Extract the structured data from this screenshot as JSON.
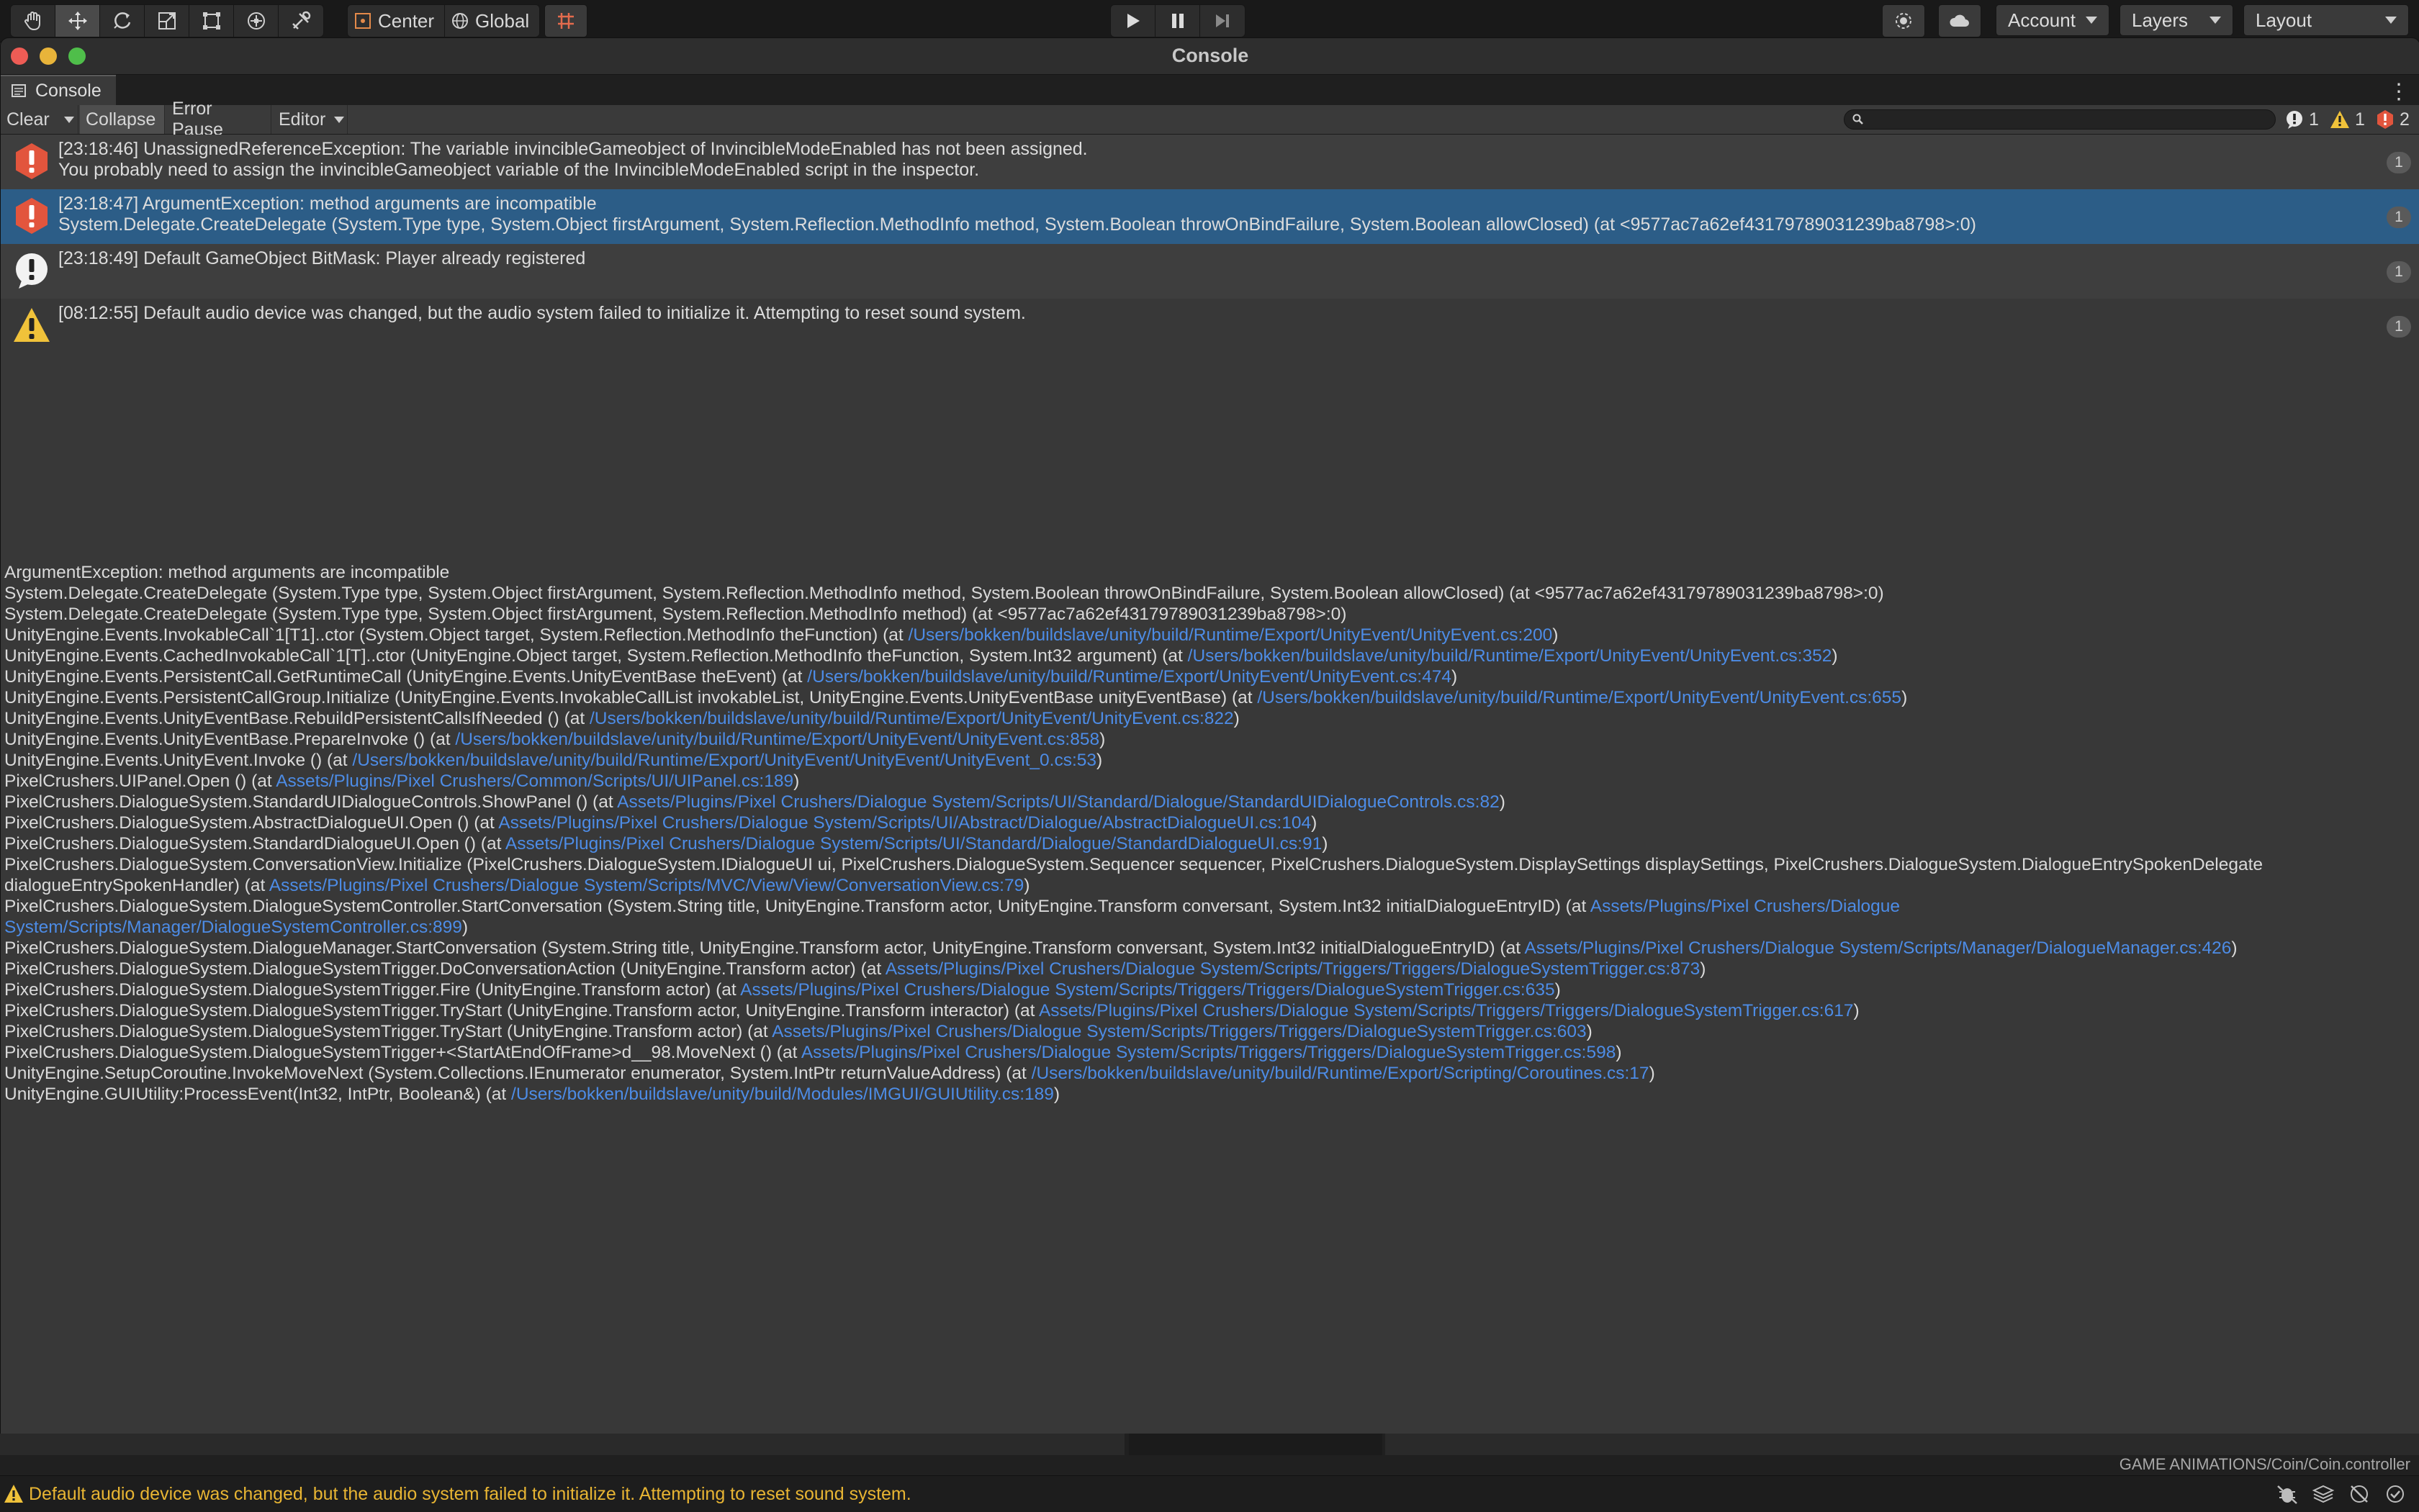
{
  "toolbar": {
    "tools": [
      "hand-tool",
      "move-tool",
      "rotate-tool",
      "scale-tool",
      "rect-tool",
      "transform-tool",
      "custom-tool"
    ],
    "pivot_label": "Center",
    "space_label": "Global",
    "account_label": "Account",
    "layers_label": "Layers",
    "layout_label": "Layout"
  },
  "window": {
    "title": "Console",
    "tab_label": "Console"
  },
  "console_toolbar": {
    "clear_label": "Clear",
    "collapse_label": "Collapse",
    "error_pause_label": "Error Pause",
    "editor_label": "Editor",
    "search_value": "",
    "info_count": "1",
    "warning_count": "1",
    "error_count": "2"
  },
  "logs": [
    {
      "type": "error",
      "line1": "[23:18:46] UnassignedReferenceException: The variable invincibleGameobject of InvincibleModeEnabled has not been assigned.",
      "line2": "You probably need to assign the invincibleGameobject variable of the InvincibleModeEnabled script in the inspector.",
      "count": "1"
    },
    {
      "type": "error",
      "line1": "[23:18:47] ArgumentException: method arguments are incompatible",
      "line2": "System.Delegate.CreateDelegate (System.Type type, System.Object firstArgument, System.Reflection.MethodInfo method, System.Boolean throwOnBindFailure, System.Boolean allowClosed) (at <9577ac7a62ef43179789031239ba8798>:0)",
      "count": "1"
    },
    {
      "type": "info",
      "line1": "[23:18:49] Default GameObject BitMask: Player already registered",
      "line2": "",
      "count": "1"
    },
    {
      "type": "warning",
      "line1": "[08:12:55] Default audio device was changed, but the audio system failed to initialize it. Attempting to reset sound system.",
      "line2": "",
      "count": "1"
    }
  ],
  "stack_trace": [
    {
      "text": "ArgumentException: method arguments are incompatible",
      "link": ""
    },
    {
      "text": "System.Delegate.CreateDelegate (System.Type type, System.Object firstArgument, System.Reflection.MethodInfo method, System.Boolean throwOnBindFailure, System.Boolean allowClosed) (at <9577ac7a62ef43179789031239ba8798>:0)",
      "link": ""
    },
    {
      "text": "System.Delegate.CreateDelegate (System.Type type, System.Object firstArgument, System.Reflection.MethodInfo method) (at <9577ac7a62ef43179789031239ba8798>:0)",
      "link": ""
    },
    {
      "text": "UnityEngine.Events.InvokableCall`1[T1]..ctor (System.Object target, System.Reflection.MethodInfo theFunction) (at ",
      "link": "/Users/bokken/buildslave/unity/build/Runtime/Export/UnityEvent/UnityEvent.cs:200",
      "tail": ")"
    },
    {
      "text": "UnityEngine.Events.CachedInvokableCall`1[T]..ctor (UnityEngine.Object target, System.Reflection.MethodInfo theFunction, System.Int32 argument) (at ",
      "link": "/Users/bokken/buildslave/unity/build/Runtime/Export/UnityEvent/UnityEvent.cs:352",
      "tail": ")"
    },
    {
      "text": "UnityEngine.Events.PersistentCall.GetRuntimeCall (UnityEngine.Events.UnityEventBase theEvent) (at ",
      "link": "/Users/bokken/buildslave/unity/build/Runtime/Export/UnityEvent/UnityEvent.cs:474",
      "tail": ")"
    },
    {
      "text": "UnityEngine.Events.PersistentCallGroup.Initialize (UnityEngine.Events.InvokableCallList invokableList, UnityEngine.Events.UnityEventBase unityEventBase) (at ",
      "link": "/Users/bokken/buildslave/unity/build/Runtime/Export/UnityEvent/UnityEvent.cs:655",
      "tail": ")"
    },
    {
      "text": "UnityEngine.Events.UnityEventBase.RebuildPersistentCallsIfNeeded () (at ",
      "link": "/Users/bokken/buildslave/unity/build/Runtime/Export/UnityEvent/UnityEvent.cs:822",
      "tail": ")"
    },
    {
      "text": "UnityEngine.Events.UnityEventBase.PrepareInvoke () (at ",
      "link": "/Users/bokken/buildslave/unity/build/Runtime/Export/UnityEvent/UnityEvent.cs:858",
      "tail": ")"
    },
    {
      "text": "UnityEngine.Events.UnityEvent.Invoke () (at ",
      "link": "/Users/bokken/buildslave/unity/build/Runtime/Export/UnityEvent/UnityEvent/UnityEvent_0.cs:53",
      "tail": ")"
    },
    {
      "text": "PixelCrushers.UIPanel.Open () (at ",
      "link": "Assets/Plugins/Pixel Crushers/Common/Scripts/UI/UIPanel.cs:189",
      "tail": ")"
    },
    {
      "text": "PixelCrushers.DialogueSystem.StandardUIDialogueControls.ShowPanel () (at ",
      "link": "Assets/Plugins/Pixel Crushers/Dialogue System/Scripts/UI/Standard/Dialogue/StandardUIDialogueControls.cs:82",
      "tail": ")"
    },
    {
      "text": "PixelCrushers.DialogueSystem.AbstractDialogueUI.Open () (at ",
      "link": "Assets/Plugins/Pixel Crushers/Dialogue System/Scripts/UI/Abstract/Dialogue/AbstractDialogueUI.cs:104",
      "tail": ")"
    },
    {
      "text": "PixelCrushers.DialogueSystem.StandardDialogueUI.Open () (at ",
      "link": "Assets/Plugins/Pixel Crushers/Dialogue System/Scripts/UI/Standard/Dialogue/StandardDialogueUI.cs:91",
      "tail": ")"
    },
    {
      "text": "PixelCrushers.DialogueSystem.ConversationView.Initialize (PixelCrushers.DialogueSystem.IDialogueUI ui, PixelCrushers.DialogueSystem.Sequencer sequencer, PixelCrushers.DialogueSystem.DisplaySettings displaySettings, PixelCrushers.DialogueSystem.DialogueEntrySpokenDelegate",
      "link": "",
      "tail": ""
    },
    {
      "text": "dialogueEntrySpokenHandler) (at ",
      "link": "Assets/Plugins/Pixel Crushers/Dialogue System/Scripts/MVC/View/View/ConversationView.cs:79",
      "tail": ")"
    },
    {
      "text": "PixelCrushers.DialogueSystem.DialogueSystemController.StartConversation (System.String title, UnityEngine.Transform actor, UnityEngine.Transform conversant, System.Int32 initialDialogueEntryID) (at ",
      "link": "Assets/Plugins/Pixel Crushers/Dialogue",
      "tail": ""
    },
    {
      "text": "",
      "link": "System/Scripts/Manager/DialogueSystemController.cs:899",
      "tail": ")"
    },
    {
      "text": "PixelCrushers.DialogueSystem.DialogueManager.StartConversation (System.String title, UnityEngine.Transform actor, UnityEngine.Transform conversant, System.Int32 initialDialogueEntryID) (at ",
      "link": "Assets/Plugins/Pixel Crushers/Dialogue System/Scripts/Manager/DialogueManager.cs:426",
      "tail": ")"
    },
    {
      "text": "PixelCrushers.DialogueSystem.DialogueSystemTrigger.DoConversationAction (UnityEngine.Transform actor) (at ",
      "link": "Assets/Plugins/Pixel Crushers/Dialogue System/Scripts/Triggers/Triggers/DialogueSystemTrigger.cs:873",
      "tail": ")"
    },
    {
      "text": "PixelCrushers.DialogueSystem.DialogueSystemTrigger.Fire (UnityEngine.Transform actor) (at ",
      "link": "Assets/Plugins/Pixel Crushers/Dialogue System/Scripts/Triggers/Triggers/DialogueSystemTrigger.cs:635",
      "tail": ")"
    },
    {
      "text": "PixelCrushers.DialogueSystem.DialogueSystemTrigger.TryStart (UnityEngine.Transform actor, UnityEngine.Transform interactor) (at ",
      "link": "Assets/Plugins/Pixel Crushers/Dialogue System/Scripts/Triggers/Triggers/DialogueSystemTrigger.cs:617",
      "tail": ")"
    },
    {
      "text": "PixelCrushers.DialogueSystem.DialogueSystemTrigger.TryStart (UnityEngine.Transform actor) (at ",
      "link": "Assets/Plugins/Pixel Crushers/Dialogue System/Scripts/Triggers/Triggers/DialogueSystemTrigger.cs:603",
      "tail": ")"
    },
    {
      "text": "PixelCrushers.DialogueSystem.DialogueSystemTrigger+<StartAtEndOfFrame>d__98.MoveNext () (at ",
      "link": "Assets/Plugins/Pixel Crushers/Dialogue System/Scripts/Triggers/Triggers/DialogueSystemTrigger.cs:598",
      "tail": ")"
    },
    {
      "text": "UnityEngine.SetupCoroutine.InvokeMoveNext (System.Collections.IEnumerator enumerator, System.IntPtr returnValueAddress) (at ",
      "link": "/Users/bokken/buildslave/unity/build/Runtime/Export/Scripting/Coroutines.cs:17",
      "tail": ")"
    },
    {
      "text": "UnityEngine.GUIUtility:ProcessEvent(Int32, IntPtr, Boolean&) (at ",
      "link": "/Users/bokken/buildslave/unity/build/Modules/IMGUI/GUIUtility.cs:189",
      "tail": ")"
    }
  ],
  "lower": {
    "path": "GAME ANIMATIONS/Coin/Coin.controller"
  },
  "status": {
    "message": "Default audio device was changed, but the audio system failed to initialize it. Attempting to reset sound system."
  },
  "colors": {
    "accent_selected": "#2c5d87",
    "error": "#e2553d",
    "warning": "#f0c23a",
    "link": "#4d8ce6"
  }
}
